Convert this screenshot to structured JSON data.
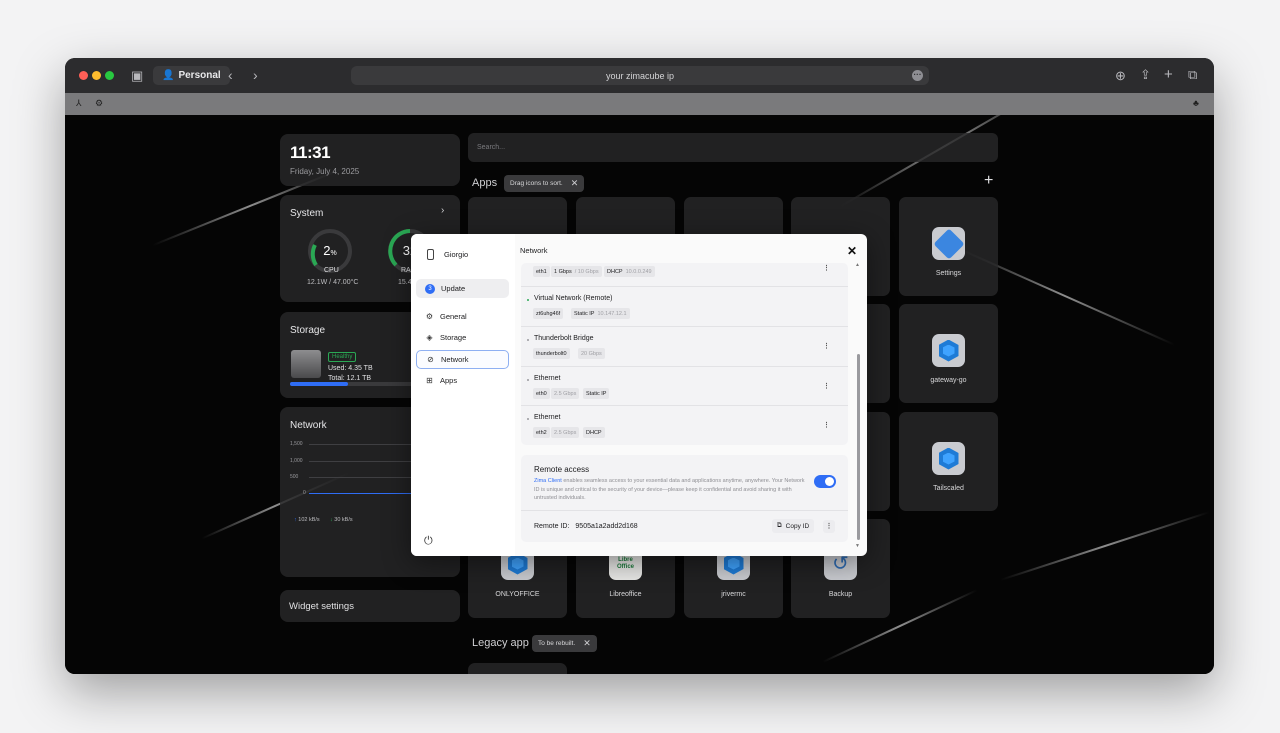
{
  "browser": {
    "profile_label": "Personal",
    "address": "your zimacube ip"
  },
  "dashboard": {
    "clock": {
      "time": "11:31",
      "date": "Friday, July 4, 2025"
    },
    "system": {
      "title": "System",
      "cpu_value": "2",
      "cpu_unit": "%",
      "cpu_label": "CPU",
      "cpu_detail": "12.1W / 47.00°C",
      "ram_value_partial": "32",
      "ram_label_partial": "RA",
      "ram_detail_partial": "15.4"
    },
    "storage": {
      "title": "Storage",
      "status": "Healthy",
      "used": "Used: 4.35 TB",
      "total": "Total: 12.1 TB",
      "used_fraction": 0.36
    },
    "network": {
      "title": "Network",
      "ticks": [
        "1,500",
        "1,000",
        "500",
        "0"
      ],
      "upload": "102 kB/s",
      "download": "30 kB/s"
    },
    "widget_settings": "Widget settings",
    "search_placeholder": "Search...",
    "apps_title": "Apps",
    "apps_hint": "Drag icons to sort.",
    "apps": [
      {
        "label": "Settings"
      },
      {
        "label": "gateway-go"
      },
      {
        "label": "Tailscaled"
      },
      {
        "label": "ONLYOFFICE"
      },
      {
        "label": "Libreoffice",
        "icon_text": "Libre Office"
      },
      {
        "label": "jrivermc"
      },
      {
        "label": "Backup"
      }
    ],
    "legacy_title": "Legacy app",
    "legacy_hint": "To be rebuilt."
  },
  "modal": {
    "user": "Giorgio",
    "update_count": "3",
    "nav": [
      "Update",
      "General",
      "Storage",
      "Network",
      "Apps"
    ],
    "title": "Network",
    "interfaces": [
      {
        "name": "",
        "chips": [
          [
            "eth1"
          ],
          [
            "1 Gbps",
            "/ 10 Gbps"
          ],
          [
            "DHCP",
            "10.0.0.249"
          ]
        ]
      },
      {
        "name": "Virtual Network (Remote)",
        "chips": [
          [
            "zt6uhg46f"
          ],
          [
            "Static IP",
            "10.147.12.1"
          ]
        ]
      },
      {
        "name": "Thunderbolt Bridge",
        "chips": [
          [
            "thunderbolt0"
          ],
          [
            "",
            "20 Gbps"
          ]
        ]
      },
      {
        "name": "Ethernet",
        "chips": [
          [
            "eth0"
          ],
          [
            "",
            "2.5 Gbps"
          ],
          [
            "Static IP"
          ]
        ]
      },
      {
        "name": "Ethernet",
        "chips": [
          [
            "eth2"
          ],
          [
            "",
            "2.5 Gbps"
          ],
          [
            "DHCP"
          ]
        ]
      }
    ],
    "remote": {
      "title": "Remote access",
      "link": "Zima Client",
      "desc": " enables seamless access to your essential data and applications anytime, anywhere. Your Network ID is unique and critical to the security of your device—please keep it confidential and avoid sharing it with untrusted individuals.",
      "enabled": true,
      "id_label": "Remote ID:",
      "id_value": "9505a1a2add2d168",
      "copy_label": "Copy ID"
    }
  }
}
